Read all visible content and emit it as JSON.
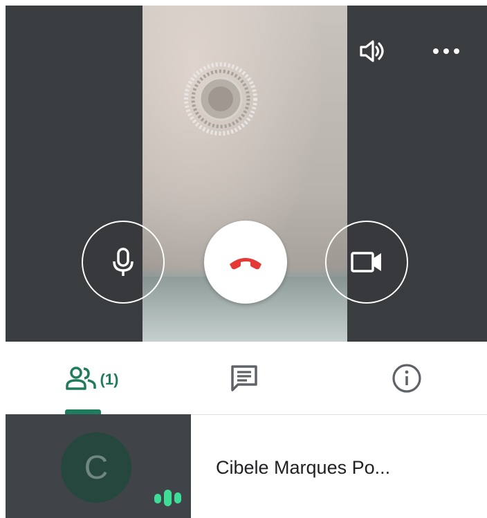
{
  "call": {
    "icons": {
      "speaker": "volume-up-icon",
      "more": "more-horizontal-icon",
      "mic": "microphone-icon",
      "end_call": "phone-hangup-icon",
      "camera": "videocam-icon"
    },
    "colors": {
      "end_call_red": "#e53935",
      "video_bg": "#3a3d40"
    }
  },
  "tabs": {
    "active": "people",
    "people": {
      "icon": "people-icon",
      "count": "(1)"
    },
    "chat": {
      "icon": "chat-icon"
    },
    "info": {
      "icon": "info-icon"
    },
    "accent_color": "#1e7b5b"
  },
  "participants": [
    {
      "initial": "C",
      "name": "Cibele Marques Po...",
      "speaking_icon": "audio-level-icon"
    }
  ]
}
